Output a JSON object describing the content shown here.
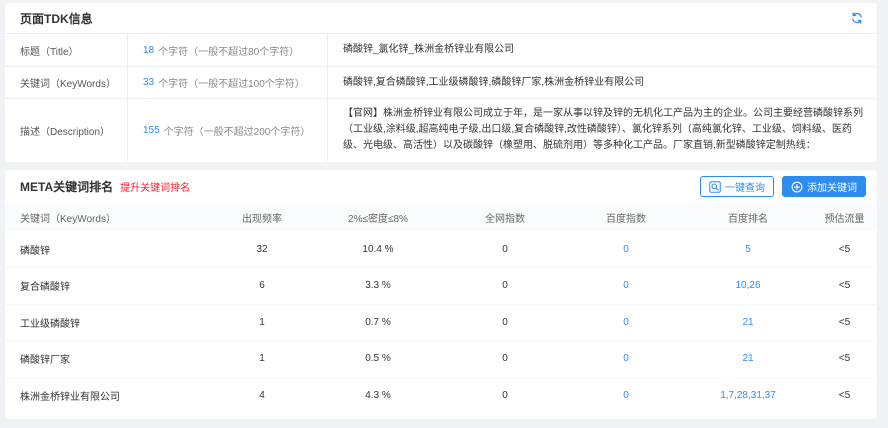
{
  "colors": {
    "accent": "#2d8cf0",
    "promo": "#f5222d",
    "background": "#f0f2f5"
  },
  "icons": {
    "refresh": "refresh-icon",
    "query": "search-icon",
    "add": "plus-circle-icon"
  },
  "tdk": {
    "title": "页面TDK信息",
    "rows": [
      {
        "label": "标题（Title）",
        "count": "18",
        "hint": "个字符（一般不超过80个字符）",
        "content": "磷酸锌_氯化锌_株洲金桥锌业有限公司"
      },
      {
        "label": "关键词（KeyWords）",
        "count": "33",
        "hint": "个字符（一般不超过100个字符）",
        "content": "磷酸锌,复合磷酸锌,工业级磷酸锌,磷酸锌厂家,株洲金桥锌业有限公司"
      },
      {
        "label": "描述（Description）",
        "count": "155",
        "hint": "个字符（一般不超过200个字符）",
        "content": "【官网】株洲金桥锌业有限公司成立于年，是一家从事以锌及锌的无机化工产品为主的企业。公司主要经营磷酸锌系列（工业级,涂料级,超高纯电子级,出口级,复合磷酸锌,改性磷酸锌）、氯化锌系列（高纯氯化锌、工业级、饲料级、医药级、光电级、高活性）以及碳酸锌（橡塑用、脱硫剂用）等多种化工产品。厂家直销,新型磷酸锌定制热线："
      }
    ]
  },
  "meta": {
    "title": "META关键词排名",
    "promo_link": "提升关键词排名",
    "query_button": "一键查询",
    "add_button": "添加关键词",
    "columns": [
      "关键词（KeyWords）",
      "出现频率",
      "2%≤密度≤8%",
      "全网指数",
      "百度指数",
      "百度排名",
      "预估流量"
    ],
    "rows": [
      {
        "keyword": "磷酸锌",
        "frequency": "32",
        "density": "10.4 %",
        "network_index": "0",
        "baidu_index": "0",
        "baidu_rank": "5",
        "estimated_traffic": "<5"
      },
      {
        "keyword": "复合磷酸锌",
        "frequency": "6",
        "density": "3.3 %",
        "network_index": "0",
        "baidu_index": "0",
        "baidu_rank": "10,26",
        "estimated_traffic": "<5"
      },
      {
        "keyword": "工业级磷酸锌",
        "frequency": "1",
        "density": "0.7 %",
        "network_index": "0",
        "baidu_index": "0",
        "baidu_rank": "21",
        "estimated_traffic": "<5"
      },
      {
        "keyword": "磷酸锌厂家",
        "frequency": "1",
        "density": "0.5 %",
        "network_index": "0",
        "baidu_index": "0",
        "baidu_rank": "21",
        "estimated_traffic": "<5"
      },
      {
        "keyword": "株洲金桥锌业有限公司",
        "frequency": "4",
        "density": "4.3 %",
        "network_index": "0",
        "baidu_index": "0",
        "baidu_rank": "1,7,28,31,37",
        "estimated_traffic": "<5"
      }
    ]
  }
}
